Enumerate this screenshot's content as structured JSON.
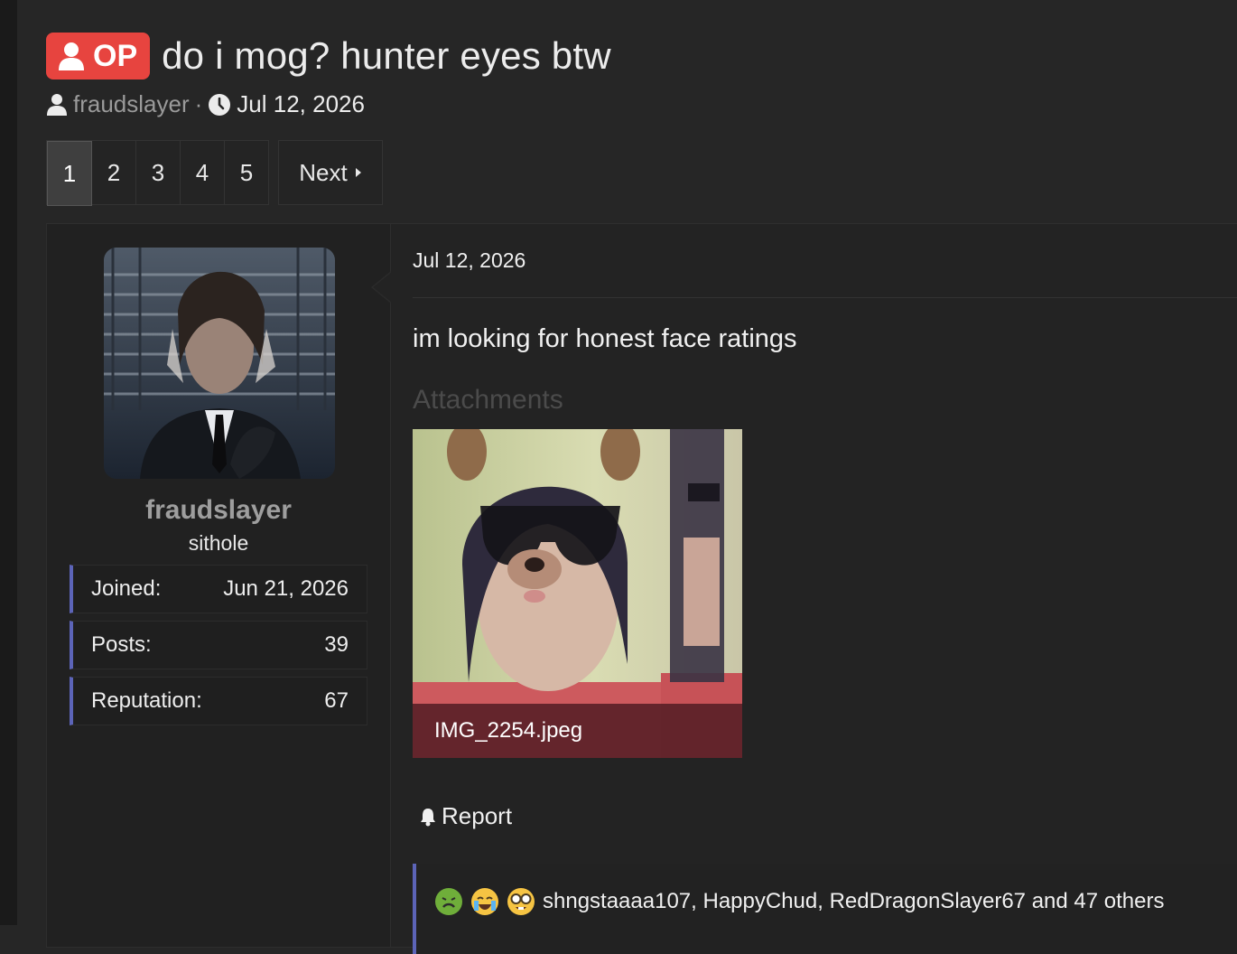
{
  "thread": {
    "badge": "OP",
    "title": "do i mog? hunter eyes btw",
    "author": "fraudslayer",
    "meta_separator": "·",
    "date": "Jul 12, 2026"
  },
  "pagination": {
    "pages": [
      "1",
      "2",
      "3",
      "4",
      "5"
    ],
    "current": "1",
    "next_label": "Next"
  },
  "user": {
    "name": "fraudslayer",
    "title": "sithole",
    "stats": [
      {
        "label": "Joined:",
        "value": "Jun 21, 2026"
      },
      {
        "label": "Posts:",
        "value": "39"
      },
      {
        "label": "Reputation:",
        "value": "67"
      }
    ]
  },
  "post": {
    "date": "Jul 12, 2026",
    "message": "im looking for honest face ratings",
    "attachments_label": "Attachments",
    "attachment_name": "IMG_2254.jpeg",
    "report_label": "Report",
    "reactions_text": "shngstaaaa107, HappyChud, RedDragonSlayer67 and 47 others"
  },
  "colors": {
    "op_badge": "#e7443f",
    "accent": "#5c64b8",
    "background": "#262626"
  },
  "icons": [
    "user-icon",
    "clock-icon",
    "caret-right-icon",
    "bell-icon",
    "sick-emoji-icon",
    "crying-emoji-icon",
    "nerd-emoji-icon"
  ]
}
